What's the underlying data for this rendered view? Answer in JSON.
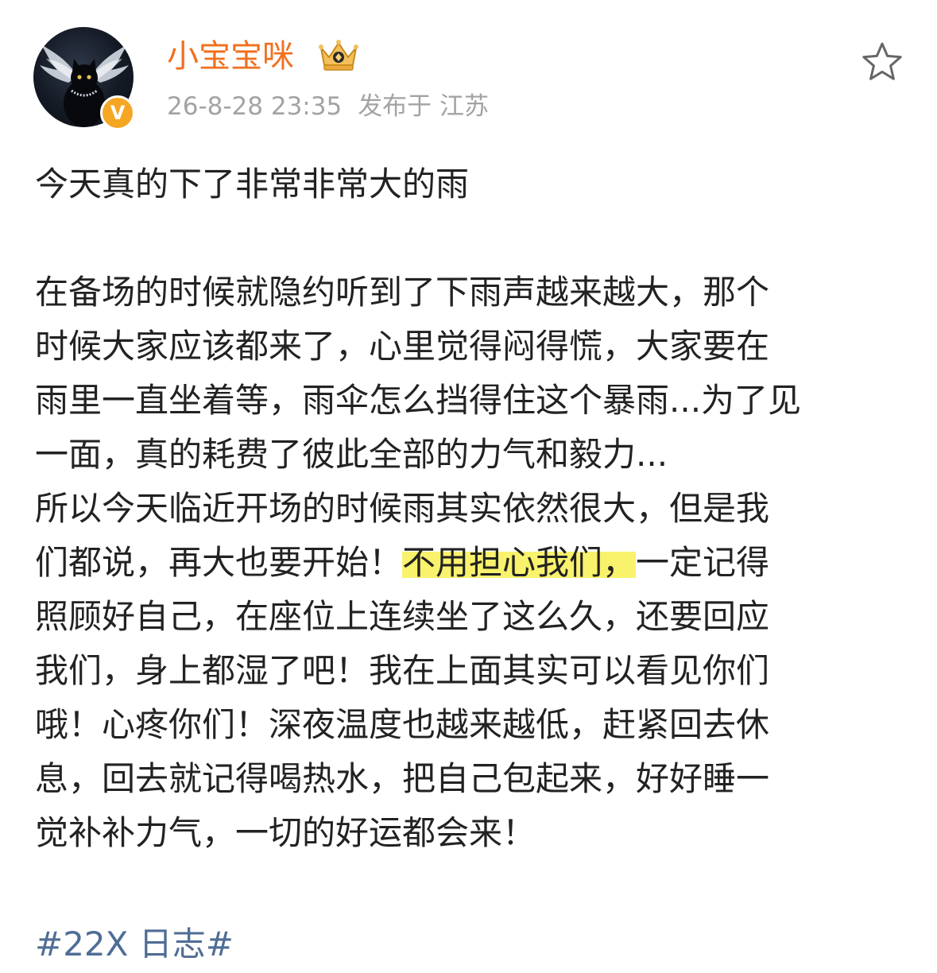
{
  "user": {
    "name": "小宝宝咪",
    "avatar_icon": "black-cat-angel-wings-avatar",
    "verified_badge_text": "V",
    "verified_badge_color": "#f5a623",
    "member_badge_icon": "crown-badge-icon",
    "name_color": "#f0701f"
  },
  "meta": {
    "datetime": "26-8-28 23:35",
    "location": "发布于 江苏"
  },
  "actions": {
    "favorite_icon": "star-outline-icon"
  },
  "post": {
    "first_line": "今天真的下了非常非常大的雨",
    "lines": [
      "在备场的时候就隐约听到了下雨声越来越大，那个",
      "时候大家应该都来了，心里觉得闷得慌，大家要在",
      "雨里一直坐着等，雨伞怎么挡得住这个暴雨...为了见",
      "一面，真的耗费了彼此全部的力气和毅力...",
      "所以今天临近开场的时候雨其实依然很大，但是我"
    ],
    "highlight_line": {
      "before": "们都说，再大也要开始！",
      "highlight": "不用担心我们，",
      "after": "一定记得"
    },
    "lines_after": [
      "照顾好自己，在座位上连续坐了这么久，还要回应",
      "我们，身上都湿了吧！我在上面其实可以看见你们",
      "哦！心疼你们！深夜温度也越来越低，赶紧回去休",
      "息，回去就记得喝热水，把自己包起来，好好睡一",
      "觉补补力气，一切的好运都会来！"
    ],
    "highlight_color": "#f9f26d"
  },
  "hashtag": "#22X 日志#",
  "hashtag_color": "#4f6d95"
}
